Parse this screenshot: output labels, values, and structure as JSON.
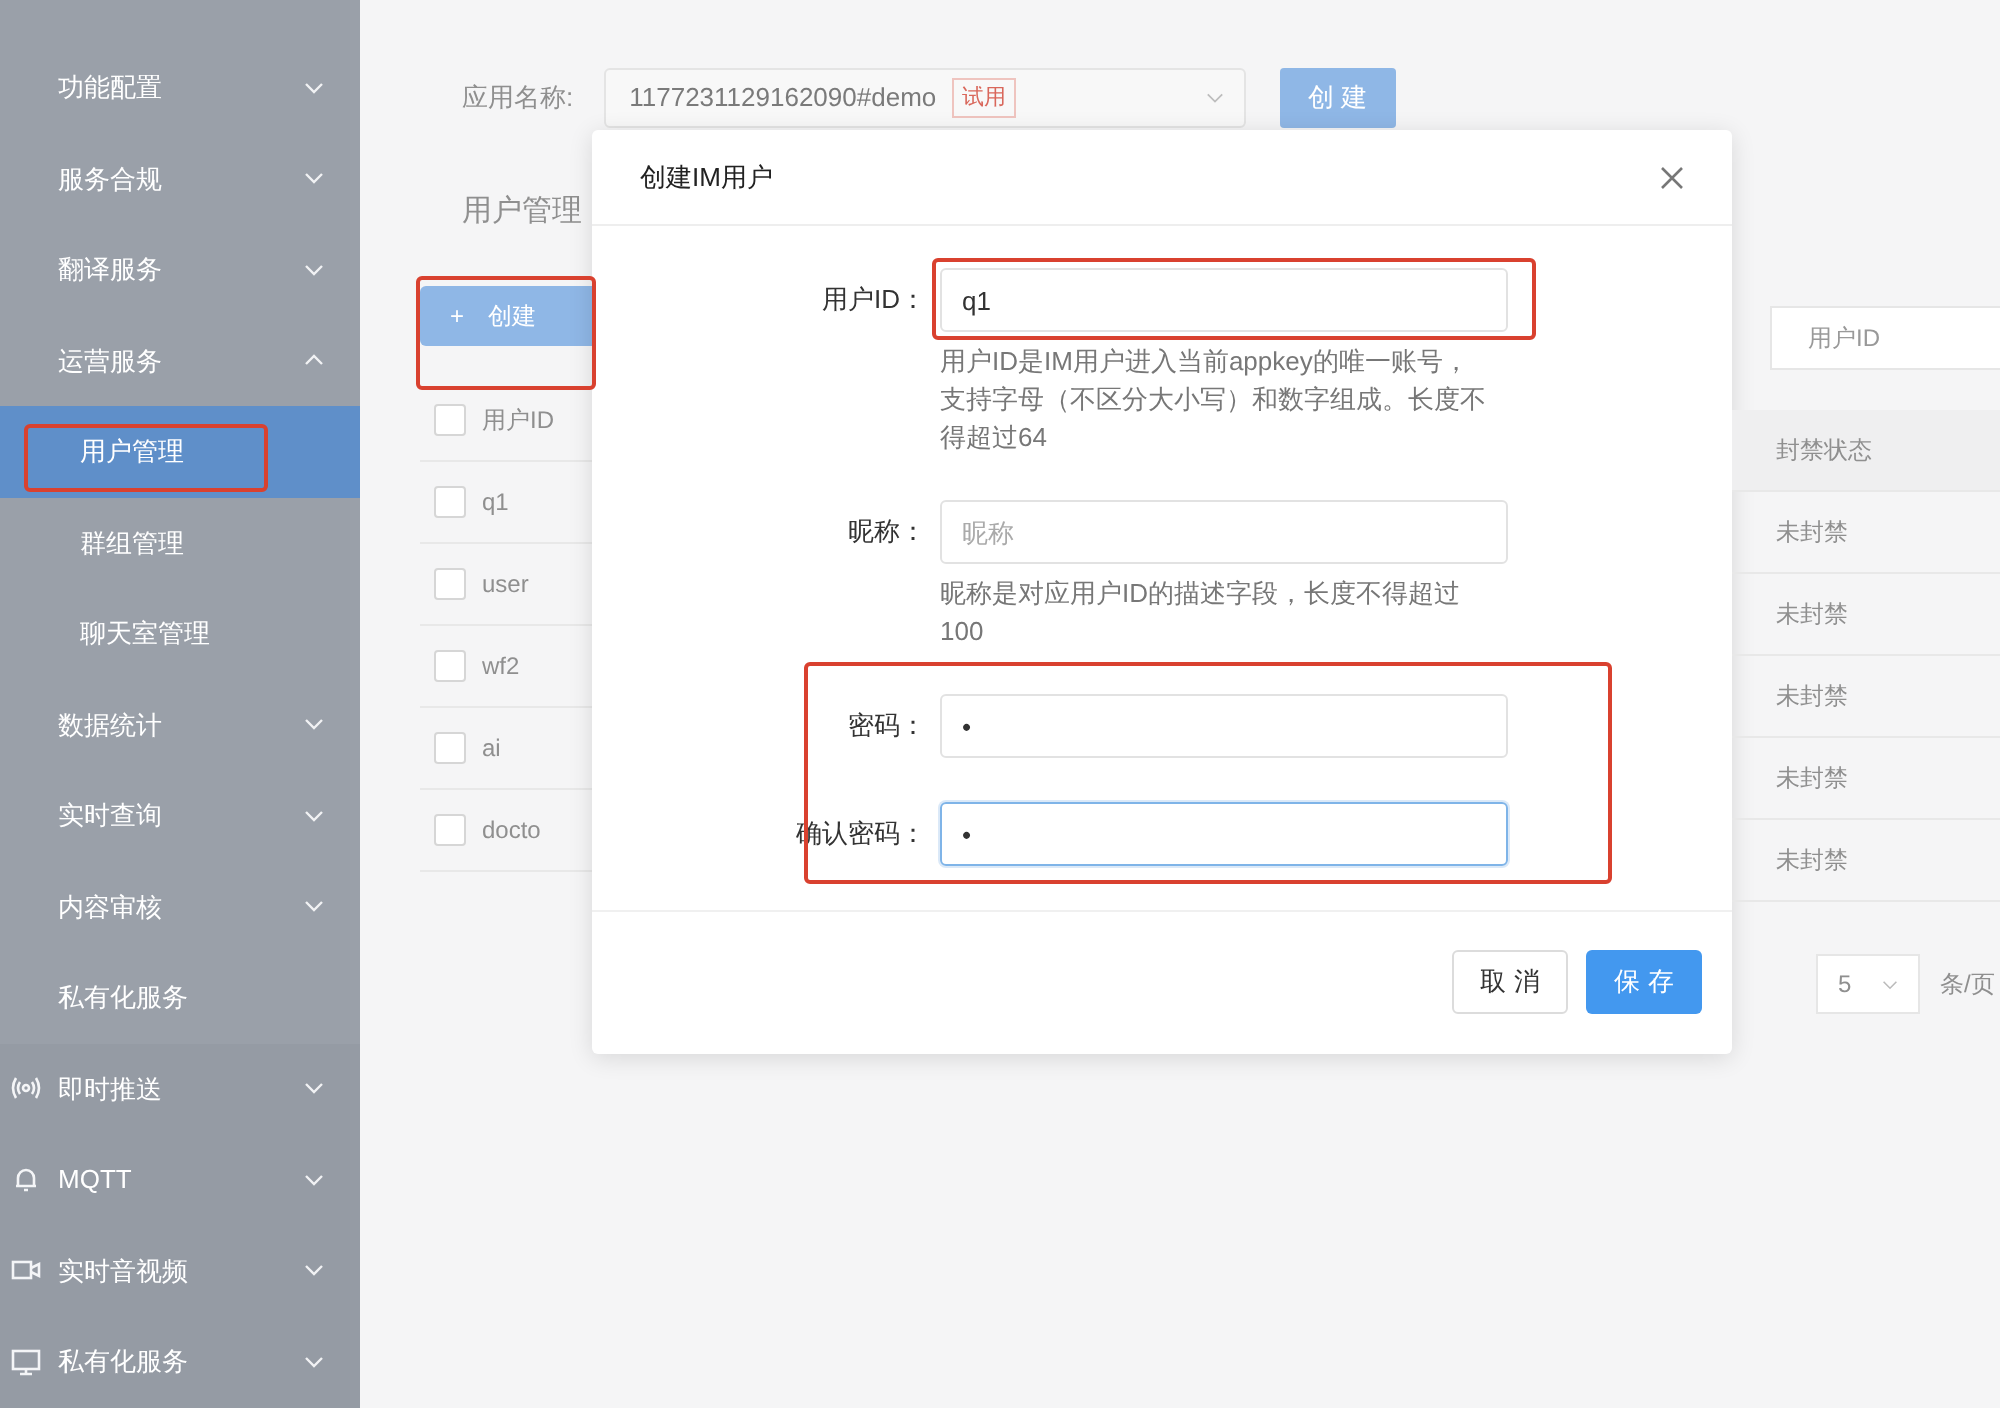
{
  "sidebar": {
    "groups": [
      {
        "items": [
          {
            "label": "功能配置",
            "expanded": false
          },
          {
            "label": "服务合规",
            "expanded": false
          },
          {
            "label": "翻译服务",
            "expanded": false
          },
          {
            "label": "运营服务",
            "expanded": true,
            "children": [
              {
                "label": "用户管理",
                "selected": true
              },
              {
                "label": "群组管理",
                "selected": false
              },
              {
                "label": "聊天室管理",
                "selected": false
              }
            ]
          },
          {
            "label": "数据统计",
            "expanded": false
          },
          {
            "label": "实时查询",
            "expanded": false
          },
          {
            "label": "内容审核",
            "expanded": false
          },
          {
            "label": "私有化服务"
          }
        ]
      },
      {
        "items": [
          {
            "label": "即时推送",
            "expanded": false
          },
          {
            "label": "MQTT",
            "expanded": false
          },
          {
            "label": "实时音视频",
            "expanded": false
          },
          {
            "label": "私有化服务",
            "expanded": false
          }
        ]
      }
    ]
  },
  "app_selector": {
    "label": "应用名称:",
    "value": "1177231129162090#demo",
    "tag": "试用",
    "button": "创 建"
  },
  "page_title": "用户管理",
  "create_button": {
    "icon": "+",
    "label": "创建"
  },
  "search": {
    "placeholder": "用户ID"
  },
  "table": {
    "left_column": {
      "heading": "用户ID",
      "heading_checked": false,
      "rows": [
        {
          "text": "q1",
          "checked": false
        },
        {
          "text": "user",
          "checked": false
        },
        {
          "text": "wf2",
          "checked": false
        },
        {
          "text": "ai",
          "checked": false
        },
        {
          "text": "docto",
          "checked": false
        }
      ]
    },
    "right_column": {
      "heading": "封禁状态",
      "cells": [
        "未封禁",
        "未封禁",
        "未封禁",
        "未封禁",
        "未封禁"
      ]
    }
  },
  "pagination": {
    "page_size": "5",
    "unit": "条/页"
  },
  "dialog": {
    "title": "创建IM用户",
    "fields": [
      {
        "label": "用户ID：",
        "value": "q1",
        "hint": "用户ID是IM用户进入当前appkey的唯一账号，支持字母（不区分大小写）和数字组成。长度不得超过64",
        "focused": false
      },
      {
        "label": "昵称：",
        "placeholder": "昵称",
        "hint": "昵称是对应用户ID的描述字段，长度不得超过100",
        "focused": false
      },
      {
        "label": "密码：",
        "value": "•",
        "focused": false
      },
      {
        "label": "确认密码：",
        "value": "•",
        "focused": true
      }
    ],
    "buttons": [
      {
        "label": "取 消",
        "kind": "secondary"
      },
      {
        "label": "保 存",
        "kind": "primary"
      }
    ]
  }
}
